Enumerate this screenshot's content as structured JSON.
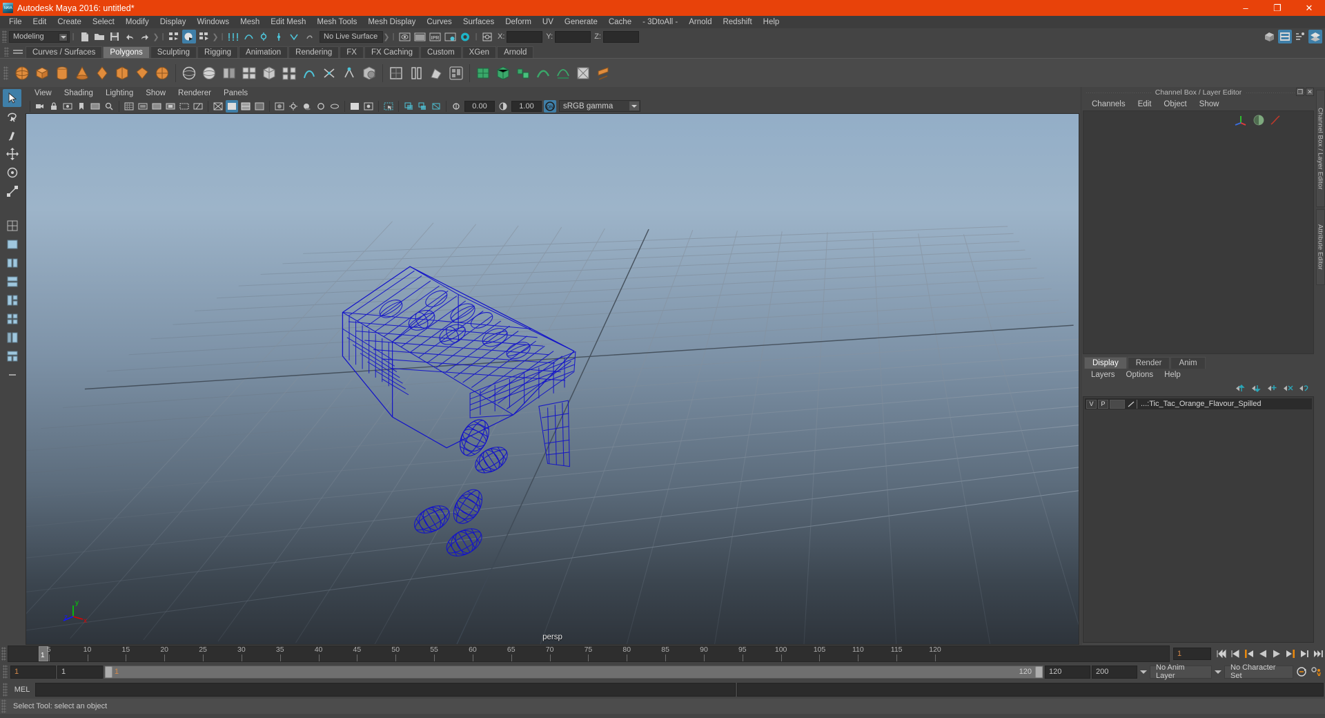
{
  "window": {
    "title": "Autodesk Maya 2016: untitled*",
    "logo_text": "MAYA",
    "minimize": "–",
    "maximize": "❐",
    "close": "✕"
  },
  "menubar": {
    "items": [
      "File",
      "Edit",
      "Create",
      "Select",
      "Modify",
      "Display",
      "Windows",
      "Mesh",
      "Edit Mesh",
      "Mesh Tools",
      "Mesh Display",
      "Curves",
      "Surfaces",
      "Deform",
      "UV",
      "Generate",
      "Cache",
      "- 3DtoAll -",
      "Arnold",
      "Redshift",
      "Help"
    ]
  },
  "statusline": {
    "menuset": "Modeling",
    "live_surface": "No Live Surface",
    "x_label": "X:",
    "y_label": "Y:",
    "z_label": "Z:",
    "x_value": "",
    "y_value": "",
    "z_value": ""
  },
  "shelf": {
    "tabs": [
      "Curves / Surfaces",
      "Polygons",
      "Sculpting",
      "Rigging",
      "Animation",
      "Rendering",
      "FX",
      "FX Caching",
      "Custom",
      "XGen",
      "Arnold"
    ],
    "selected_tab": "Polygons"
  },
  "viewport_menu": {
    "items": [
      "View",
      "Shading",
      "Lighting",
      "Show",
      "Renderer",
      "Panels"
    ]
  },
  "viewport_toolbar": {
    "exposure": "0.00",
    "gamma": "1.00",
    "color_management_state": "ON",
    "view_transform": "sRGB gamma"
  },
  "viewport": {
    "camera_label": "persp",
    "axis_x": "x",
    "axis_y": "y",
    "axis_z": "z",
    "wireframe_color": "#1414c8",
    "grid_color": "#6a7480"
  },
  "right_panel": {
    "title": "Channel Box / Layer Editor",
    "undock_icon": "❐",
    "close_icon": "✕",
    "channelbox_menu": [
      "Channels",
      "Edit",
      "Object",
      "Show"
    ],
    "layer_editor": {
      "tabs": [
        "Display",
        "Render",
        "Anim"
      ],
      "selected_tab": "Display",
      "menu": [
        "Layers",
        "Options",
        "Help"
      ],
      "layers": [
        {
          "visibility": "V",
          "playback": "P",
          "color": "",
          "name": "...:Tic_Tac_Orange_Flavour_Spilled"
        }
      ]
    },
    "vertical_tabs": [
      "Channel Box / Layer Editor",
      "Attribute Editor"
    ]
  },
  "timeline": {
    "ticks": [
      5,
      10,
      15,
      20,
      25,
      30,
      35,
      40,
      45,
      50,
      55,
      60,
      65,
      70,
      75,
      80,
      85,
      90,
      95,
      100,
      105,
      110,
      115,
      120
    ],
    "current_frame": "1",
    "start": 1,
    "end": 120,
    "playhead_label": "1",
    "playback_buttons": [
      "go-to-start",
      "step-back-key",
      "step-back-frame",
      "play-backwards",
      "play-forwards",
      "step-forward-frame",
      "step-forward-key",
      "go-to-end"
    ]
  },
  "range_slider": {
    "anim_start": "1",
    "range_start": "1",
    "range_start_bar": "1",
    "range_end_bar": "120",
    "range_end": "120",
    "anim_end": "200",
    "anim_layer": "No Anim Layer",
    "character_set": "No Character Set"
  },
  "command_line": {
    "language": "MEL",
    "value": "",
    "placeholder": ""
  },
  "help_line": {
    "text": "Select Tool: select an object"
  },
  "colors": {
    "title_bar": "#e8420a",
    "panel_bg": "#444444",
    "accent_blue": "#3f7fa8",
    "accent_orange": "#d58a4a",
    "shelf_icon": "#e08c3c"
  }
}
